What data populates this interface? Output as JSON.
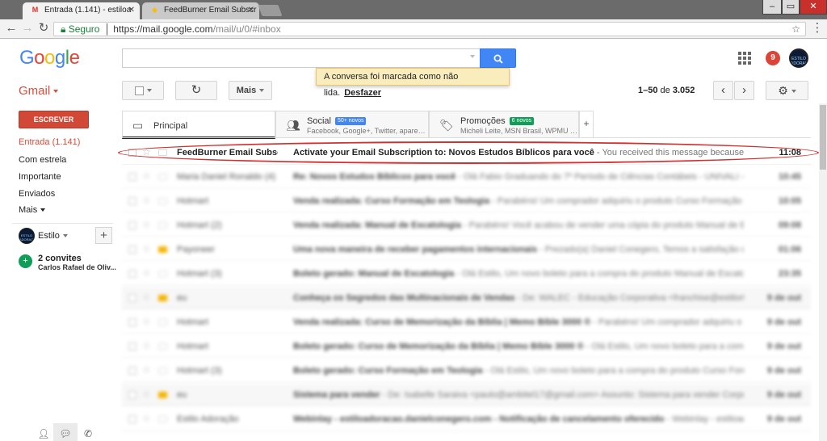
{
  "browser": {
    "tabs": [
      {
        "title": "Entrada (1.141) - estiloa",
        "favicon": "gmail-icon"
      },
      {
        "title": "FeedBurner Email Subscr",
        "favicon": "gmail-icon"
      }
    ],
    "url_secure": "Seguro",
    "url_host": "https://mail.google.com",
    "url_path": "/mail/u/0/#inbox"
  },
  "header": {
    "logo_letters": [
      "G",
      "o",
      "o",
      "g",
      "l",
      "e"
    ],
    "logo_colors": [
      "#4285f4",
      "#ea4335",
      "#fbbc05",
      "#4285f4",
      "#34a853",
      "#ea4335"
    ],
    "notification_count": "9",
    "avatar_text": "ESTILO ADORAÇÃO"
  },
  "toast": {
    "message": "A conversa foi marcada como não lida.",
    "undo": "Desfazer"
  },
  "toolbar": {
    "app_label": "Gmail",
    "more_label": "Mais",
    "range": "1–50",
    "range_of": "de",
    "total": "3.052"
  },
  "sidebar": {
    "compose": "ESCREVER",
    "items": [
      {
        "label": "Entrada (1.141)",
        "active": true
      },
      {
        "label": "Com estrela",
        "active": false
      },
      {
        "label": "Importante",
        "active": false
      },
      {
        "label": "Enviados",
        "active": false
      },
      {
        "label": "Mais",
        "active": false
      }
    ],
    "hangouts_user": "Estilo",
    "invites_title": "2 convites",
    "invites_sub": "Carlos Rafael de Oliv..."
  },
  "category_tabs": [
    {
      "label": "Principal",
      "badge": "",
      "snippet": ""
    },
    {
      "label": "Social",
      "badge": "50+ novos",
      "snippet": "Facebook, Google+, Twitter, aparecid..."
    },
    {
      "label": "Promoções",
      "badge": "6 novos",
      "snippet": "Micheli Leite, MSN Brasil, WPMU DE..."
    }
  ],
  "emails": [
    {
      "sender": "FeedBurner Email Subscri.",
      "subject": "Activate your Email Subscription to: Novos Estudos Bíblicos para você",
      "snippet": " - You received this message because someone reques",
      "time": "11:08",
      "important": false,
      "read": false
    },
    {
      "sender": "Maria Daniel Ronaldo (4)",
      "subject": "Re: Novos Estudos Bíblicos para você",
      "snippet": " - Olá Fabio Graduando do 7º Período de Ciências Contábeis - UNIVALI - Biguaçu Tu",
      "time": "10:45",
      "important": false,
      "read": false
    },
    {
      "sender": "Hotmart",
      "subject": "Venda realizada: Curso Formação em Teologia",
      "snippet": " - Parabéns! Um comprador adquiriu o produto Curso Formação em Teologia atra",
      "time": "10:05",
      "important": false,
      "read": false
    },
    {
      "sender": "Hotmart (2)",
      "subject": "Venda realizada: Manual de Escatologia",
      "snippet": " - Parabéns! Você acabou de vender uma cópia do produto Manual de Escatologia! Você",
      "time": "09:08",
      "important": false,
      "read": false
    },
    {
      "sender": "Payoneer",
      "subject": "Uma nova maneira de receber pagamentos internacionais",
      "snippet": " - Prezado(a) Daniel Conegero, Temos a satisfação de informá-lo(a) q",
      "time": "01:06",
      "important": true,
      "read": false
    },
    {
      "sender": "Hotmart (3)",
      "subject": "Boleto gerado: Manual de Escatologia",
      "snippet": " - Olá Estilo, Um novo boleto para a compra do produto Manual de Escatologia",
      "time": "23:35",
      "important": false,
      "read": false
    },
    {
      "sender": "eu",
      "subject": "Conheça os Segredos das Multinacionais de Vendas",
      "snippet": " - De: WALEC - Educação Corporativa <franchise@estilorte.com.br> Assunto",
      "time": "9 de out",
      "important": true,
      "read": true
    },
    {
      "sender": "Hotmart",
      "subject": "Venda realizada: Curso de Memorização da Bíblia | Memo Bíble 3000 ®",
      "snippet": " - Parabéns! Um comprador adquiriu o produto Curso de Memo",
      "time": "9 de out",
      "important": false,
      "read": false
    },
    {
      "sender": "Hotmart",
      "subject": "Boleto gerado: Curso de Memorização da Bíblia | Memo Bíble 3000 ®",
      "snippet": " - Olá Estilo, Um novo boleto para a compra do produto Curso de",
      "time": "9 de out",
      "important": false,
      "read": false
    },
    {
      "sender": "Hotmart (3)",
      "subject": "Boleto gerado: Curso Formação em Teologia",
      "snippet": " - Olá Estilo, Um novo boleto para a compra do produto Curso Formação em Teolog",
      "time": "9 de out",
      "important": false,
      "read": false
    },
    {
      "sender": "eu",
      "subject": "Sistema para vender",
      "snippet": " - De: Isabelle Saraiva <paulo@ambitel17@gmail.com> Assunto: Sistema para vender Corpo da mensagem: Est",
      "time": "9 de out",
      "important": true,
      "read": true
    },
    {
      "sender": "Estilo Adoração",
      "subject": "Webinlay - estiloadoracao.danielconegero.com - Notificação de cancelamento oferecido",
      "snippet": " - Webinlay - estiloadoracao",
      "time": "9 de out",
      "important": false,
      "read": false
    }
  ]
}
